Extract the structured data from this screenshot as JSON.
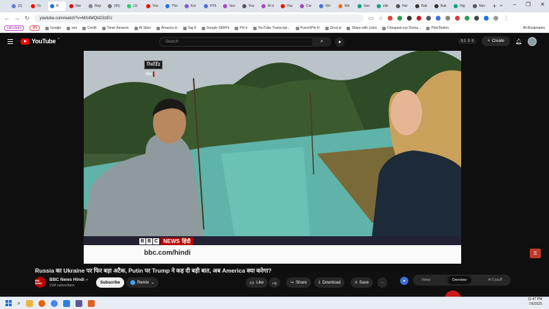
{
  "browser": {
    "tabs": [
      {
        "label": "(2)",
        "color": "#5b7fd6"
      },
      {
        "label": "Yo",
        "color": "#ff0000"
      },
      {
        "label": "R",
        "color": "#1a73e8",
        "active": true
      },
      {
        "label": "Net",
        "color": "#e50914"
      },
      {
        "label": "Rep",
        "color": "#888888"
      },
      {
        "label": "(45)",
        "color": "#777777"
      },
      {
        "label": "(11",
        "color": "#25d366"
      },
      {
        "label": "You",
        "color": "#ff0000"
      },
      {
        "label": "Y5o",
        "color": "#1a73e8"
      },
      {
        "label": "Kor",
        "color": "#7b5bd6"
      },
      {
        "label": "HTh",
        "color": "#4a6fdc"
      },
      {
        "label": "Ven",
        "color": "#aa44cc"
      },
      {
        "label": "You",
        "color": "#555555"
      },
      {
        "label": "AI d",
        "color": "#aa44cc"
      },
      {
        "label": "You",
        "color": "#ff0000"
      },
      {
        "label": "Cor",
        "color": "#aa44cc"
      },
      {
        "label": "43+",
        "color": "#4a6fdc"
      },
      {
        "label": "Wri",
        "color": "#e07020"
      },
      {
        "label": "Sen",
        "color": "#10a37f"
      },
      {
        "label": "elle",
        "color": "#10a37f"
      },
      {
        "label": "Hor",
        "color": "#555555"
      },
      {
        "label": "Bak",
        "color": "#333333"
      },
      {
        "label": "Bak",
        "color": "#333333"
      },
      {
        "label": "Hig",
        "color": "#10a37f"
      },
      {
        "label": "Nev",
        "color": "#555555"
      }
    ],
    "new_tab": "+",
    "window_controls": [
      "⌄",
      "–",
      "❐",
      "✕"
    ],
    "url": "youtube.com/watch?v=MX4MQbD3zEU",
    "bookmarks": [
      {
        "label": "calculator",
        "style": "pill"
      },
      {
        "label": "dfk",
        "style": "pill2"
      },
      {
        "label": "Google"
      },
      {
        "label": "seo"
      },
      {
        "label": "Credit"
      },
      {
        "label": "Timer Amazon"
      },
      {
        "label": "AI Sites"
      },
      {
        "label": "Amazon.in"
      },
      {
        "label": "Tag tt"
      },
      {
        "label": "Google SERPs"
      },
      {
        "label": "Pin it"
      },
      {
        "label": "YouTube Transcript..."
      },
      {
        "label": "Punch/Pin It!"
      },
      {
        "label": "Zinut ai"
      },
      {
        "label": "Share with Links"
      },
      {
        "label": "Cheapest.xyz Doma..."
      },
      {
        "label": "Pinit Button"
      }
    ],
    "all_bookmarks": "All Bookmarks"
  },
  "youtube": {
    "logo_text": "YouTube",
    "logo_country": "IN",
    "search_placeholder": "Search",
    "create_label": "Create",
    "header_stats": [
      "0.1",
      "0",
      "0"
    ]
  },
  "video": {
    "overlay_recorded": "रिकॉर्डेड",
    "overlay_sub": "फ़ीड",
    "bbc_letters": [
      "B",
      "B",
      "C"
    ],
    "bbc_news": "NEWS",
    "bbc_hindi": "हिंदी",
    "bbc_url": "bbc.com/hindi",
    "title": "Russia का Ukraine पर फिर बड़ा अटैक, Putin पर Trump ने कह दी बड़ी बात, अब America क्या करेगा?"
  },
  "channel": {
    "avatar_text": "BBC NEWS",
    "name": "BBC News Hindi",
    "verified": "✔",
    "subscribers": "21M subscribers",
    "subscribe_label": "Subscribe",
    "remix_label": "Remix"
  },
  "actions": {
    "like": "Like",
    "share": "Share",
    "download": "Download",
    "save": "Save",
    "more": "···"
  },
  "side_panel": {
    "tabs": [
      "Views",
      "Overview",
      "AI Coach"
    ],
    "active_tab": "Overview"
  },
  "taskbar": {
    "time": "11:47 PM",
    "date": "7/6/2025"
  }
}
